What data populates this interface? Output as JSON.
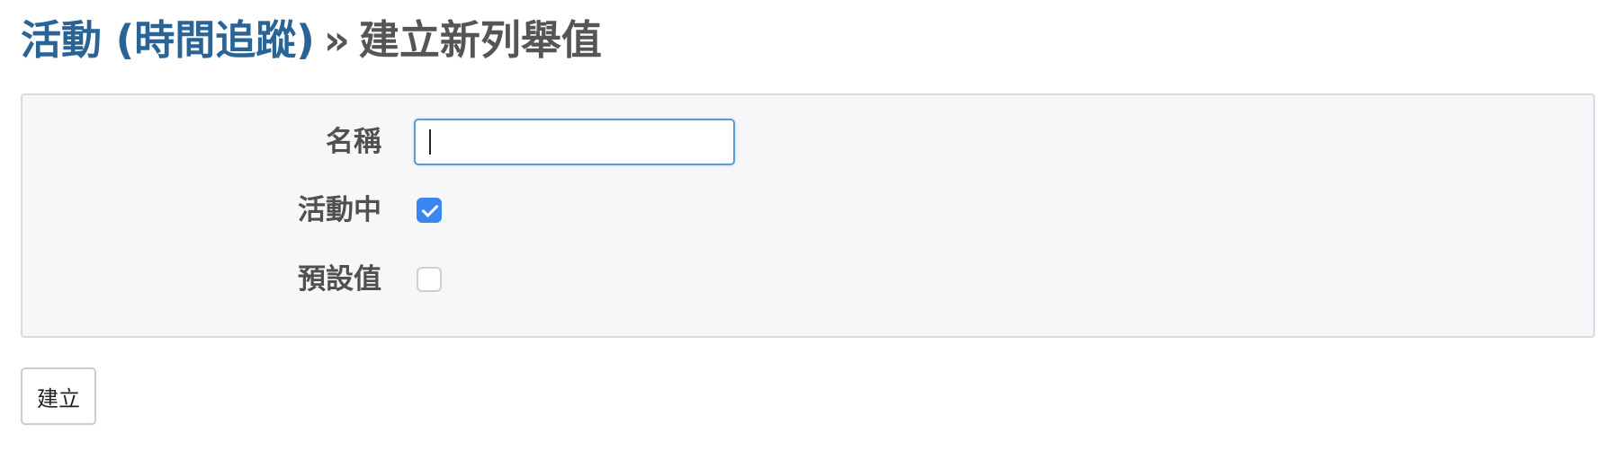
{
  "header": {
    "breadcrumb_link": "活動 (時間追蹤)",
    "separator": "»",
    "title": "建立新列舉值"
  },
  "form": {
    "name": {
      "label": "名稱",
      "value": ""
    },
    "active": {
      "label": "活動中",
      "checked": true
    },
    "default": {
      "label": "預設值",
      "checked": false
    }
  },
  "actions": {
    "create_label": "建立"
  },
  "colors": {
    "link": "#2a6496",
    "checkbox_checked": "#3b86f0",
    "input_focus_border": "#5b9bd5",
    "panel_background": "#f6f7f9"
  }
}
